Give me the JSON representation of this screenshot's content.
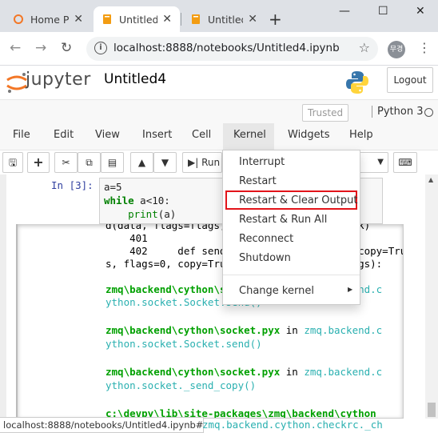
{
  "browser": {
    "tabs": [
      {
        "label": "Home P",
        "icon": "jupyter-favicon",
        "active": false
      },
      {
        "label": "Untitled",
        "icon": "notebook-favicon",
        "active": true
      },
      {
        "label": "Untitled",
        "icon": "notebook-favicon",
        "active": false
      }
    ],
    "new_tab": "+",
    "url": "localhost:8888/notebooks/Untitled4.ipynb",
    "profile_label": "무경"
  },
  "jupyter": {
    "logo_text": "jupyter",
    "notebook_title": "Untitled4",
    "logout_label": "Logout",
    "trusted_label": "Trusted",
    "kernel_name": "Python 3",
    "menu": [
      "File",
      "Edit",
      "View",
      "Insert",
      "Cell",
      "Kernel",
      "Widgets",
      "Help"
    ],
    "open_menu": "Kernel",
    "run_label": "Run"
  },
  "kernel_menu": {
    "items": [
      "Interrupt",
      "Restart",
      "Restart & Clear Output",
      "Restart & Run All",
      "Reconnect",
      "Shutdown"
    ],
    "submenu_item": "Change kernel",
    "highlighted": "Restart & Clear Output"
  },
  "cell": {
    "prompt": "In [3]:",
    "code_lines": {
      "l1": "a=5",
      "l2_kw": "while",
      "l2_rest": " a<10:",
      "l3_fn": "print",
      "l3_rest": "(a)"
    }
  },
  "output": {
    "lines": [
      "d(data, flags=flags, copy=copy, track=track)",
      "    401",
      "    402     def send(self, data, flags=0, copy=True, track=False, routing_id=None, group=None): part",
      "s, flags=0, copy=True, track=False, **kwargs):"
    ],
    "traces": [
      {
        "path": "zmq\\backend\\cython\\socket.pyx",
        "in": "in",
        "func1": "zmq.backend.c",
        "func2": "ython.socket.Socket.send()"
      },
      {
        "path": "zmq\\backend\\cython\\socket.pyx",
        "in": "in",
        "func1": "zmq.backend.c",
        "func2": "ython.socket.Socket.send()"
      },
      {
        "path": "zmq\\backend\\cython\\socket.pyx",
        "in": "in",
        "func1": "zmq.backend.c",
        "func2": "ython.socket._send_copy()"
      }
    ],
    "last_line": "c:\\devpy\\lib\\site-packages\\zmq\\backend\\cython"
  },
  "statusbar": {
    "url": "localhost:8888/notebooks/Untitled4.ipynb#",
    "trailing": "zmq.backend.cython.checkrc._ch"
  },
  "colors": {
    "highlight_border": "#e2141a",
    "prompt_blue": "#303f9f",
    "trace_green": "#00a000",
    "trace_cyan": "#2ab0b0"
  }
}
